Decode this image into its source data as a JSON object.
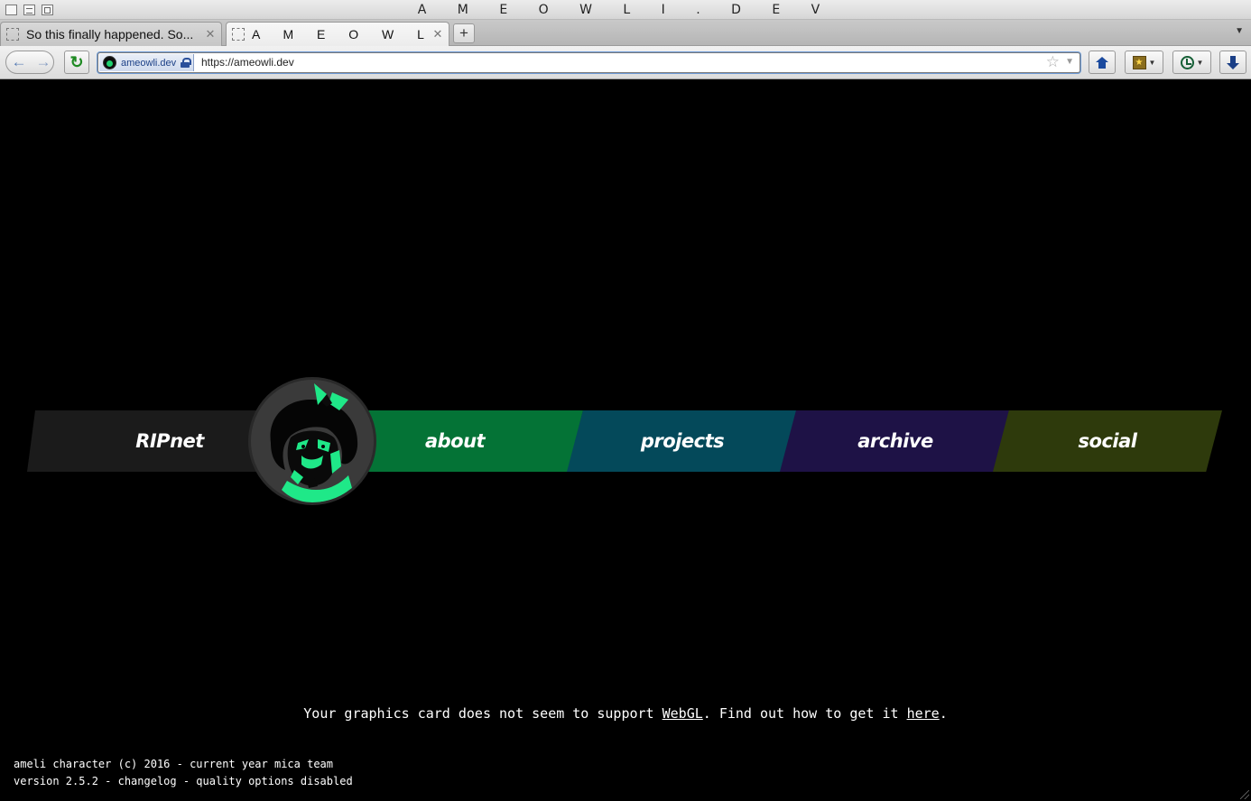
{
  "window": {
    "title": "A M E O W L I . D E V"
  },
  "tabs": [
    {
      "label": "So this finally happened. So...",
      "active": false
    },
    {
      "label": "A M E O W L I...",
      "active": true
    }
  ],
  "navbar": {
    "identity_label": "ameowli.dev",
    "url": "https://ameowli.dev"
  },
  "page": {
    "menu": [
      {
        "label": "RIPnet",
        "color": "#1b1b1b"
      },
      {
        "label": "about",
        "color": "#047336"
      },
      {
        "label": "projects",
        "color": "#04495a"
      },
      {
        "label": "archive",
        "color": "#1e1246"
      },
      {
        "label": "social",
        "color": "#2e3a0c"
      }
    ],
    "accent_color": "#1fe888",
    "webgl": {
      "before": "Your graphics card does not seem to support ",
      "link1": "WebGL",
      "middle": ". Find out how to get it ",
      "link2": "here",
      "after": "."
    },
    "footer": {
      "line1": "ameli character (c) 2016 - current year mica team",
      "line2": "version 2.5.2 - changelog - quality options disabled"
    }
  },
  "icons": {
    "back": "back-arrow-icon",
    "forward": "forward-arrow-icon",
    "reload": "reload-icon",
    "home": "home-icon",
    "bookmarks": "bookmarks-icon",
    "history": "history-clock-icon",
    "downloads": "download-icon"
  }
}
